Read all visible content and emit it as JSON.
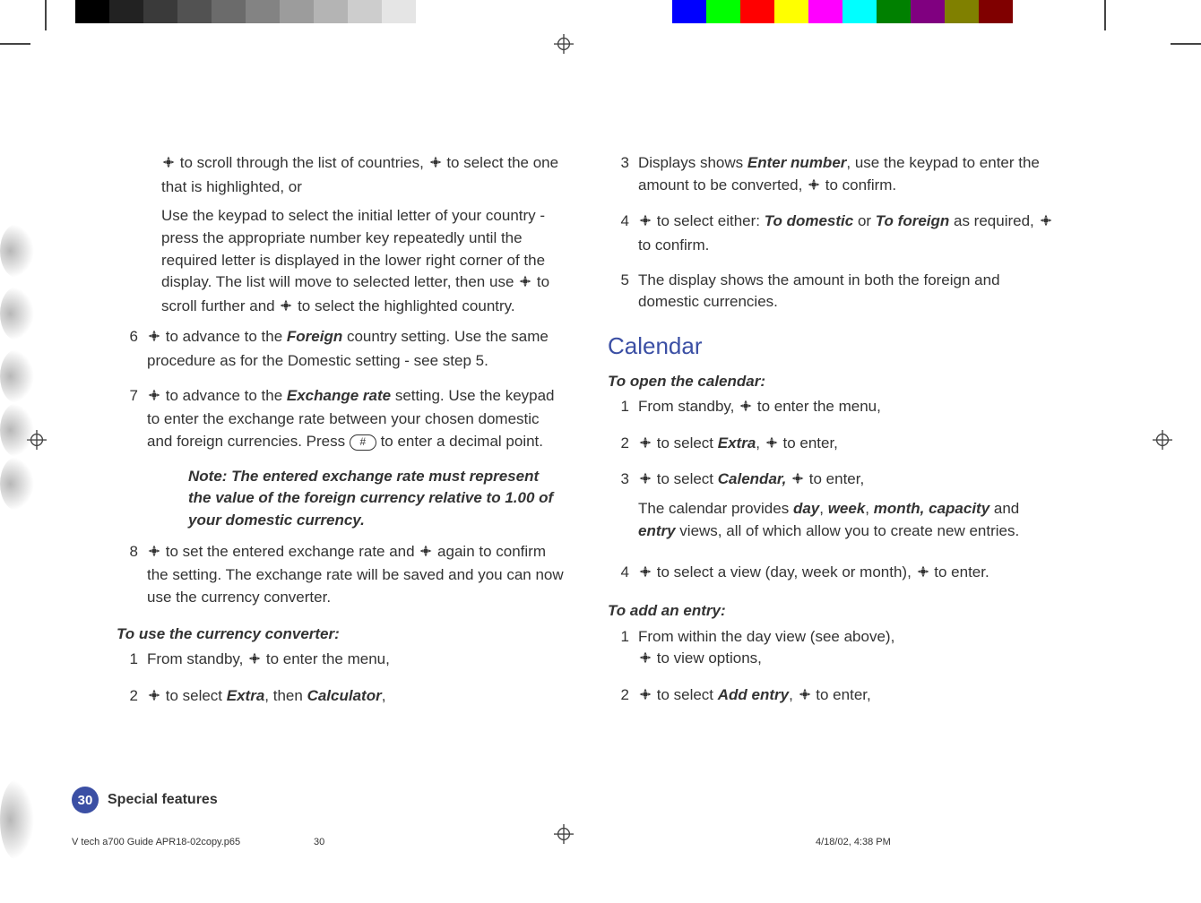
{
  "print": {
    "grays": [
      "#000000",
      "#222222",
      "#3a3a3a",
      "#525252",
      "#6b6b6b",
      "#838383",
      "#9c9c9c",
      "#b4b4b4",
      "#cdcdcd",
      "#e5e5e5",
      "#ffffff"
    ],
    "colors": [
      "#0000ff",
      "#00ff00",
      "#ff0000",
      "#ffff00",
      "#ff00ff",
      "#00ffff",
      "#008000",
      "#800080",
      "#808000",
      "#800000"
    ]
  },
  "left": {
    "p5a": " to scroll through the list of countries, ",
    "p5b": " to select the one that is highlighted, or",
    "p5c": "Use the keypad to select the initial letter of your country - press the appropriate number key repeatedly until the required letter is displayed in the lower right corner of the display. The list will move to selected letter, then use ",
    "p5d": " to scroll further and ",
    "p5e": " to select the highlighted country.",
    "s6n": "6",
    "s6a": " to advance to the ",
    "s6word": "Foreign",
    "s6b": " country setting. Use the same procedure as for the Domestic setting - see step 5.",
    "s7n": "7",
    "s7a": " to advance to the ",
    "s7word": "Exchange rate",
    "s7b": " setting. Use the keypad to enter the exchange rate between your chosen domestic and foreign currencies. Press ",
    "s7key": "#",
    "s7c": " to enter a decimal point.",
    "note": "Note: The entered exchange rate must represent the value of the foreign currency relative to 1.00 of your domestic currency.",
    "s8n": "8",
    "s8a": " to set the entered exchange rate and ",
    "s8b": " again to confirm the setting. The exchange rate will be saved and you can now use the currency converter.",
    "subhead1": "To use the currency converter:",
    "u1n": "1",
    "u1a": "From standby, ",
    "u1b": " to enter the menu,",
    "u2n": "2",
    "u2a": " to select ",
    "u2word1": "Extra",
    "u2b": ", then ",
    "u2word2": "Calculator",
    "u2c": ","
  },
  "right": {
    "s3n": "3",
    "s3a": "Displays shows ",
    "s3word": "Enter number",
    "s3b": ", use the keypad to enter the amount to be converted, ",
    "s3c": " to confirm.",
    "s4n": "4",
    "s4a": " to select either: ",
    "s4w1": "To domestic",
    "s4b": " or ",
    "s4w2": "To foreign",
    "s4c": " as required, ",
    "s4d": " to confirm.",
    "s5n": "5",
    "s5a": "The display shows the amount in both the foreign and domestic currencies.",
    "h2": "Calendar",
    "sub1": "To open the calendar:",
    "c1n": "1",
    "c1a": "From standby, ",
    "c1b": " to enter the menu,",
    "c2n": "2",
    "c2a": " to select ",
    "c2w": "Extra",
    "c2b": ", ",
    "c2c": " to enter,",
    "c3n": "3",
    "c3a": " to select ",
    "c3w": "Calendar,",
    "c3b": " ",
    "c3c": " to enter,",
    "c3note1": "The calendar provides ",
    "c3w1": "day",
    "c3s1": ", ",
    "c3w2": "week",
    "c3s2": ", ",
    "c3w3": "month, capacity",
    "c3s3": " and ",
    "c3w4": "entry",
    "c3note2": " views, all of which allow you to create new entries.",
    "c4n": "4",
    "c4a": " to select a view (day, week or month), ",
    "c4b": " to enter.",
    "sub2": "To add an entry:",
    "a1n": "1",
    "a1a": "From within the day view (see above),",
    "a1b": " to view options,",
    "a2n": "2",
    "a2a": " to select ",
    "a2w": "Add entry",
    "a2b": ", ",
    "a2c": " to enter,"
  },
  "footer": {
    "page_num": "30",
    "section": "Special features",
    "file": "V tech a700 Guide APR18-02copy.p65",
    "mid": "30",
    "date": "4/18/02, 4:38 PM"
  }
}
